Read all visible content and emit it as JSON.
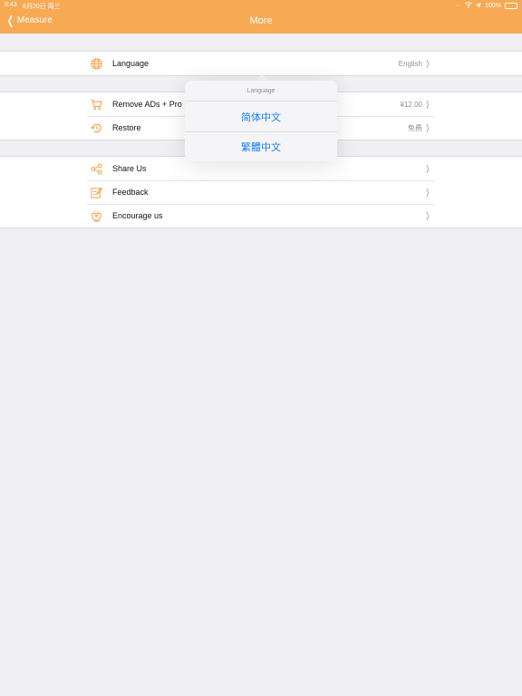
{
  "status": {
    "time": "8:43",
    "date": "6月20日 周三",
    "battery": "100%",
    "battery_level": 1.0
  },
  "nav": {
    "back_label": "Measure",
    "title": "More"
  },
  "sections": {
    "language": {
      "label": "Language",
      "value": "English"
    },
    "purchase": {
      "remove_ads_label": "Remove ADs + Pro",
      "remove_ads_value": "¥12.00",
      "restore_label": "Restore",
      "restore_value": "免费"
    },
    "social": {
      "share_label": "Share Us",
      "feedback_label": "Feedback",
      "encourage_label": "Encourage us"
    }
  },
  "popover": {
    "title": "Language",
    "options": [
      "简体中文",
      "繁體中文"
    ]
  },
  "colors": {
    "accent": "#f7a954",
    "link": "#1a7ff1",
    "icon": "#f29a3a"
  }
}
